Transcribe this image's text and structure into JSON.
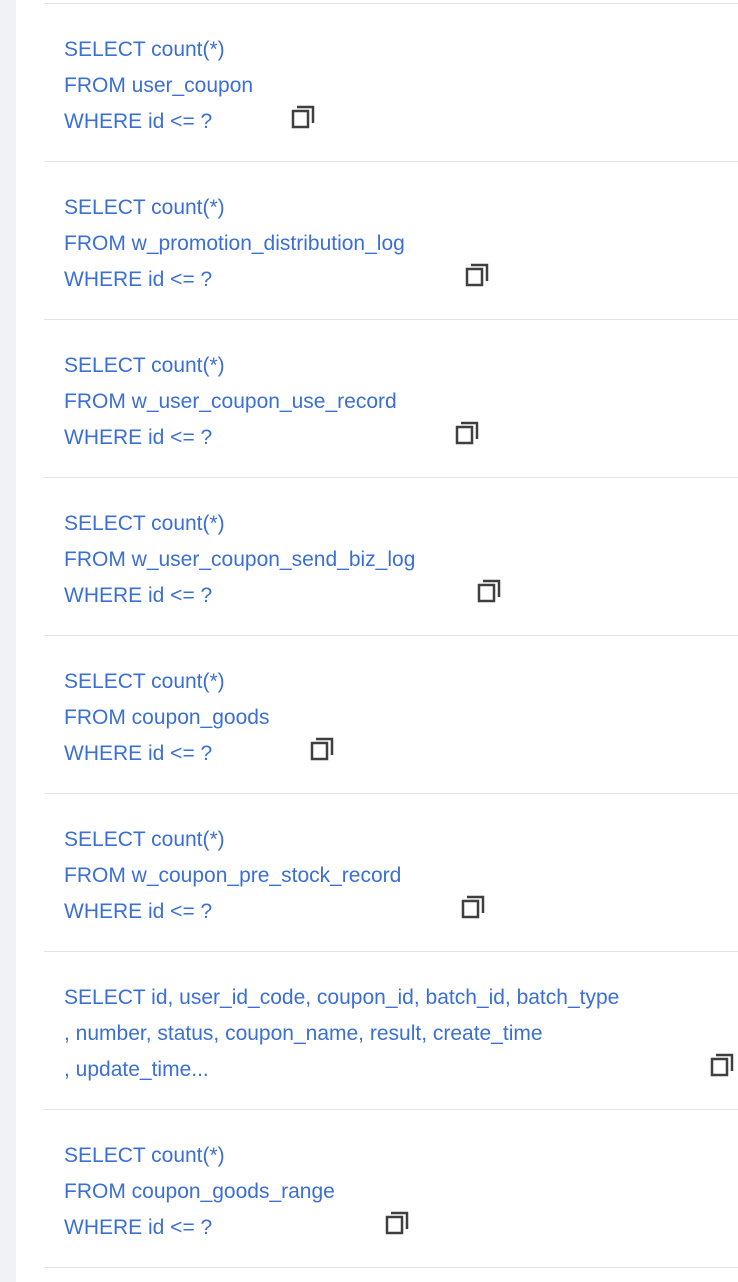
{
  "sql_list": {
    "items": [
      {
        "line1": "SELECT count(*)",
        "line2": "FROM user_coupon",
        "line3": "WHERE id <= ?",
        "copy_icon": "copy-icon"
      },
      {
        "line1": "SELECT count(*)",
        "line2": "FROM w_promotion_distribution_log",
        "line3": "WHERE id <= ?",
        "copy_icon": "copy-icon"
      },
      {
        "line1": "SELECT count(*)",
        "line2": "FROM w_user_coupon_use_record",
        "line3": "WHERE id <= ?",
        "copy_icon": "copy-icon"
      },
      {
        "line1": "SELECT count(*)",
        "line2": "FROM w_user_coupon_send_biz_log",
        "line3": "WHERE id <= ?",
        "copy_icon": "copy-icon"
      },
      {
        "line1": "SELECT count(*)",
        "line2": "FROM coupon_goods",
        "line3": "WHERE id <= ?",
        "copy_icon": "copy-icon"
      },
      {
        "line1": "SELECT count(*)",
        "line2": "FROM w_coupon_pre_stock_record",
        "line3": "WHERE id <= ?",
        "copy_icon": "copy-icon"
      },
      {
        "line1": "SELECT id, user_id_code, coupon_id, batch_id, batch_type",
        "line2": ", number, status, coupon_name, result, create_time",
        "line3": ", update_time...",
        "copy_icon": "copy-icon"
      },
      {
        "line1": "SELECT count(*)",
        "line2": "FROM coupon_goods_range",
        "line3": "WHERE id <= ?",
        "copy_icon": "copy-icon"
      }
    ]
  },
  "colors": {
    "sql_text": "#3b6fd6",
    "divider": "#e3e5e8",
    "icon": "#3f3f3f",
    "side_strip": "#f0f2f5"
  }
}
